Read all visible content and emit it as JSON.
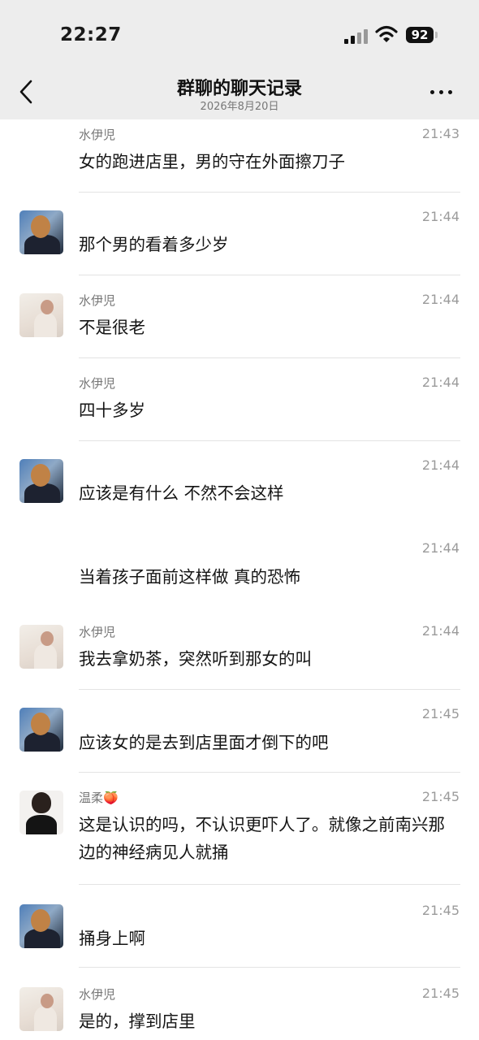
{
  "status": {
    "time": "22:27",
    "battery": "92"
  },
  "header": {
    "title": "群聊的聊天记录",
    "subtitle": "2026年8月20日"
  },
  "messages": [
    {
      "sender": "水伊児",
      "time": "21:43",
      "text": "女的跑进店里，男的守在外面擦刀子"
    },
    {
      "sender": "",
      "time": "21:44",
      "text": "那个男的看着多少岁"
    },
    {
      "sender": "水伊児",
      "time": "21:44",
      "text": "不是很老"
    },
    {
      "sender": "水伊児",
      "time": "21:44",
      "text": "四十多岁"
    },
    {
      "sender": "",
      "time": "21:44",
      "text": "应该是有什么 不然不会这样"
    },
    {
      "sender": "",
      "time": "21:44",
      "text": "当着孩子面前这样做 真的恐怖"
    },
    {
      "sender": "水伊児",
      "time": "21:44",
      "text": "我去拿奶茶，突然听到那女的叫"
    },
    {
      "sender": "",
      "time": "21:45",
      "text": "应该女的是去到店里面才倒下的吧"
    },
    {
      "sender": "温柔🍑",
      "time": "21:45",
      "text": "这是认识的吗，不认识更吓人了。就像之前南兴那边的神经病见人就捅"
    },
    {
      "sender": "",
      "time": "21:45",
      "text": "捅身上啊"
    },
    {
      "sender": "水伊児",
      "time": "21:45",
      "text": "是的，撑到店里"
    }
  ]
}
